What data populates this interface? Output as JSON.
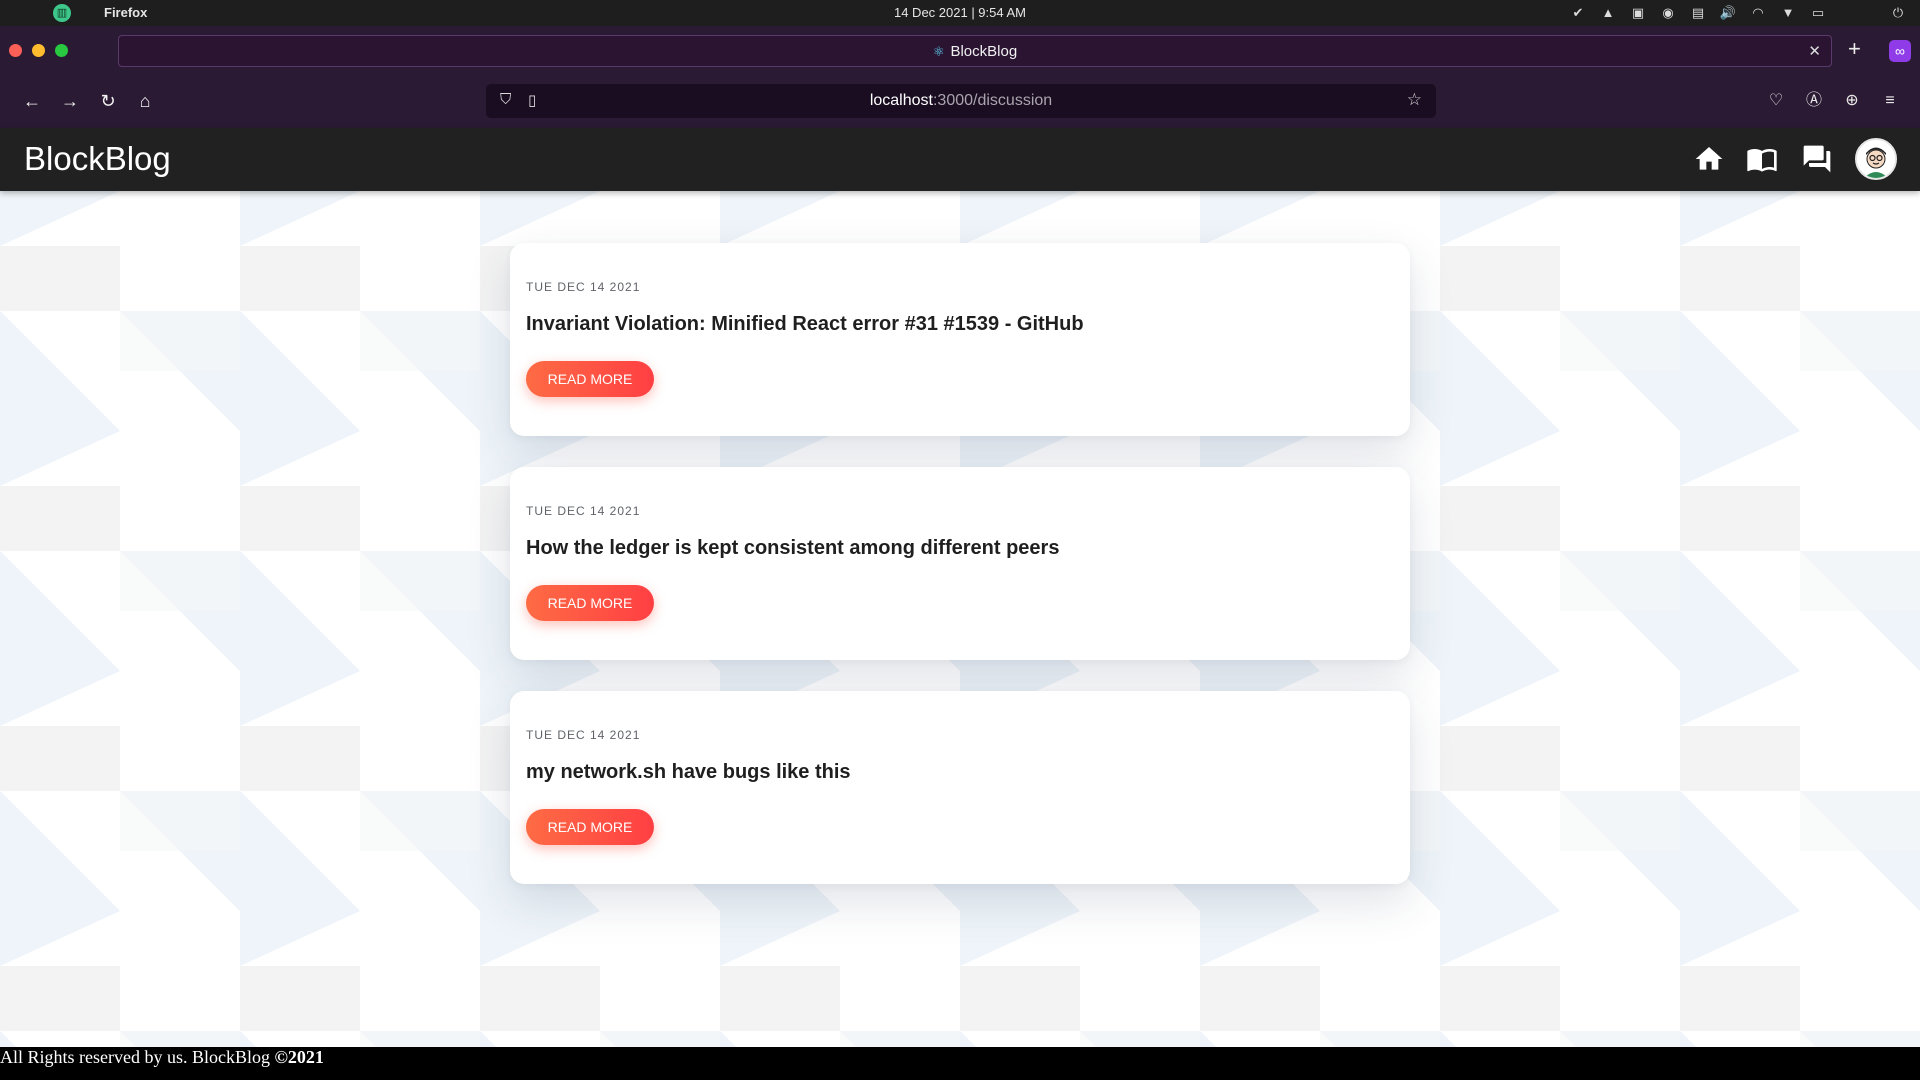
{
  "os": {
    "app_name": "Firefox",
    "clock": "14 Dec 2021 | 9:54 AM"
  },
  "browser": {
    "tab_title": "BlockBlog",
    "url_host": "localhost",
    "url_path": ":3000/discussion"
  },
  "header": {
    "brand": "BlockBlog"
  },
  "posts": [
    {
      "date": "TUE DEC 14 2021",
      "title": "Invariant Violation: Minified React error #31 #1539 - GitHub",
      "button": "READ MORE"
    },
    {
      "date": "TUE DEC 14 2021",
      "title": "How the ledger is kept consistent among different peers",
      "button": "READ MORE"
    },
    {
      "date": "TUE DEC 14 2021",
      "title": "my network.sh have bugs like this",
      "button": "READ MORE"
    }
  ],
  "footer": {
    "text": "All Rights reserved by us. BlockBlog ",
    "copyright": "©2021"
  },
  "colors": {
    "accent": "#ff5a43",
    "header_bg": "#212121",
    "browser_bg": "#2b1a33"
  }
}
